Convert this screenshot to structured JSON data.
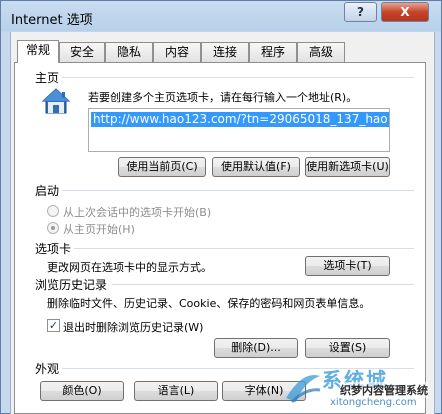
{
  "window": {
    "title": "Internet 选项",
    "help_label": "?",
    "close_label": "X"
  },
  "tabs": [
    {
      "label": "常规",
      "active": true
    },
    {
      "label": "安全"
    },
    {
      "label": "隐私"
    },
    {
      "label": "内容"
    },
    {
      "label": "连接"
    },
    {
      "label": "程序"
    },
    {
      "label": "高级"
    }
  ],
  "home": {
    "section_label": "主页",
    "description": "若要创建多个主页选项卡，请在每行输入一个地址(R)。",
    "url": "http://www.hao123.com/?tn=29065018_137_hao",
    "buttons": [
      "使用当前页(C)",
      "使用默认值(F)",
      "使用新选项卡(U)"
    ]
  },
  "startup": {
    "section_label": "启动",
    "options": [
      {
        "label": "从上次会话中的选项卡开始(B)",
        "checked": false
      },
      {
        "label": "从主页开始(H)",
        "checked": true
      }
    ]
  },
  "tabs_section": {
    "section_label": "选项卡",
    "description": "更改网页在选项卡中的显示方式。",
    "button": "选项卡(T)"
  },
  "history": {
    "section_label": "浏览历史记录",
    "description": "删除临时文件、历史记录、Cookie、保存的密码和网页表单信息。",
    "checkbox_label": "退出时删除浏览历史记录(W)",
    "checkbox_checked": true,
    "delete_button": "删除(D)...",
    "settings_button": "设置(S)"
  },
  "appearance": {
    "section_label": "外观",
    "buttons": [
      "颜色(O)",
      "语言(L)",
      "字体(N)"
    ]
  },
  "watermark": {
    "big": "系统城",
    "mid": "织梦内容管理系统",
    "small": "xitongcheng.com"
  },
  "colors": {
    "url_highlight": "#3399ff",
    "close_button": "#c5452a",
    "title_bar": "#b8d0ea",
    "watermark": "#3a9ad9"
  },
  "icons": {
    "home": "house-icon",
    "checkbox_mark": "check-icon"
  }
}
